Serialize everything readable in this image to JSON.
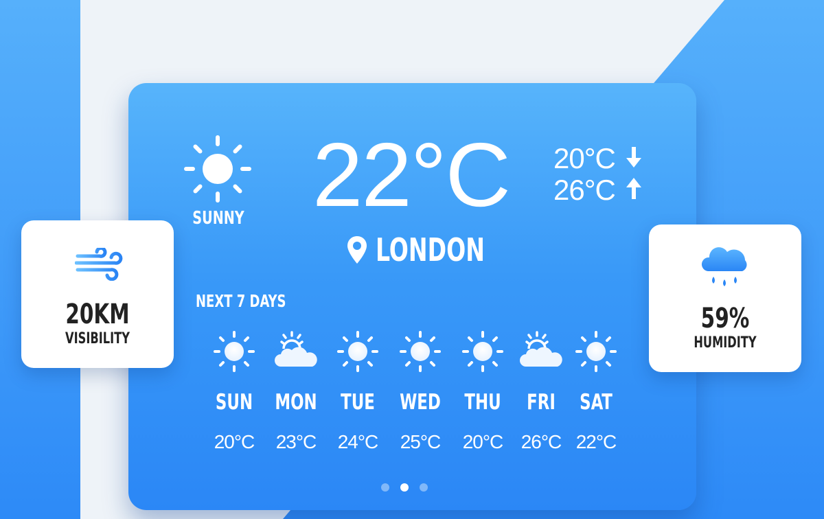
{
  "current": {
    "temperature": "22°C",
    "condition": "SUNNY",
    "condition_icon": "sun-icon",
    "low": "20°C",
    "high": "26°C",
    "location": "LONDON"
  },
  "forecast": {
    "heading": "NEXT 7 DAYS",
    "days": [
      {
        "day": "SUN",
        "temp": "20°C",
        "icon": "sun-icon"
      },
      {
        "day": "MON",
        "temp": "23°C",
        "icon": "partly-cloudy-icon"
      },
      {
        "day": "TUE",
        "temp": "24°C",
        "icon": "sun-icon"
      },
      {
        "day": "WED",
        "temp": "25°C",
        "icon": "sun-icon"
      },
      {
        "day": "THU",
        "temp": "20°C",
        "icon": "sun-icon"
      },
      {
        "day": "FRI",
        "temp": "26°C",
        "icon": "partly-cloudy-icon"
      },
      {
        "day": "SAT",
        "temp": "22°C",
        "icon": "sun-icon"
      }
    ]
  },
  "visibility": {
    "value": "20KM",
    "label": "VISIBILITY",
    "icon": "wind-icon"
  },
  "humidity": {
    "value": "59%",
    "label": "HUMIDITY",
    "icon": "rain-cloud-icon"
  },
  "pagination": {
    "active_index": 1
  },
  "colors": {
    "card_top": "#57b4fb",
    "card_bottom": "#2b87f6",
    "accent": "#2f8ff7",
    "text_dark": "#222222"
  }
}
